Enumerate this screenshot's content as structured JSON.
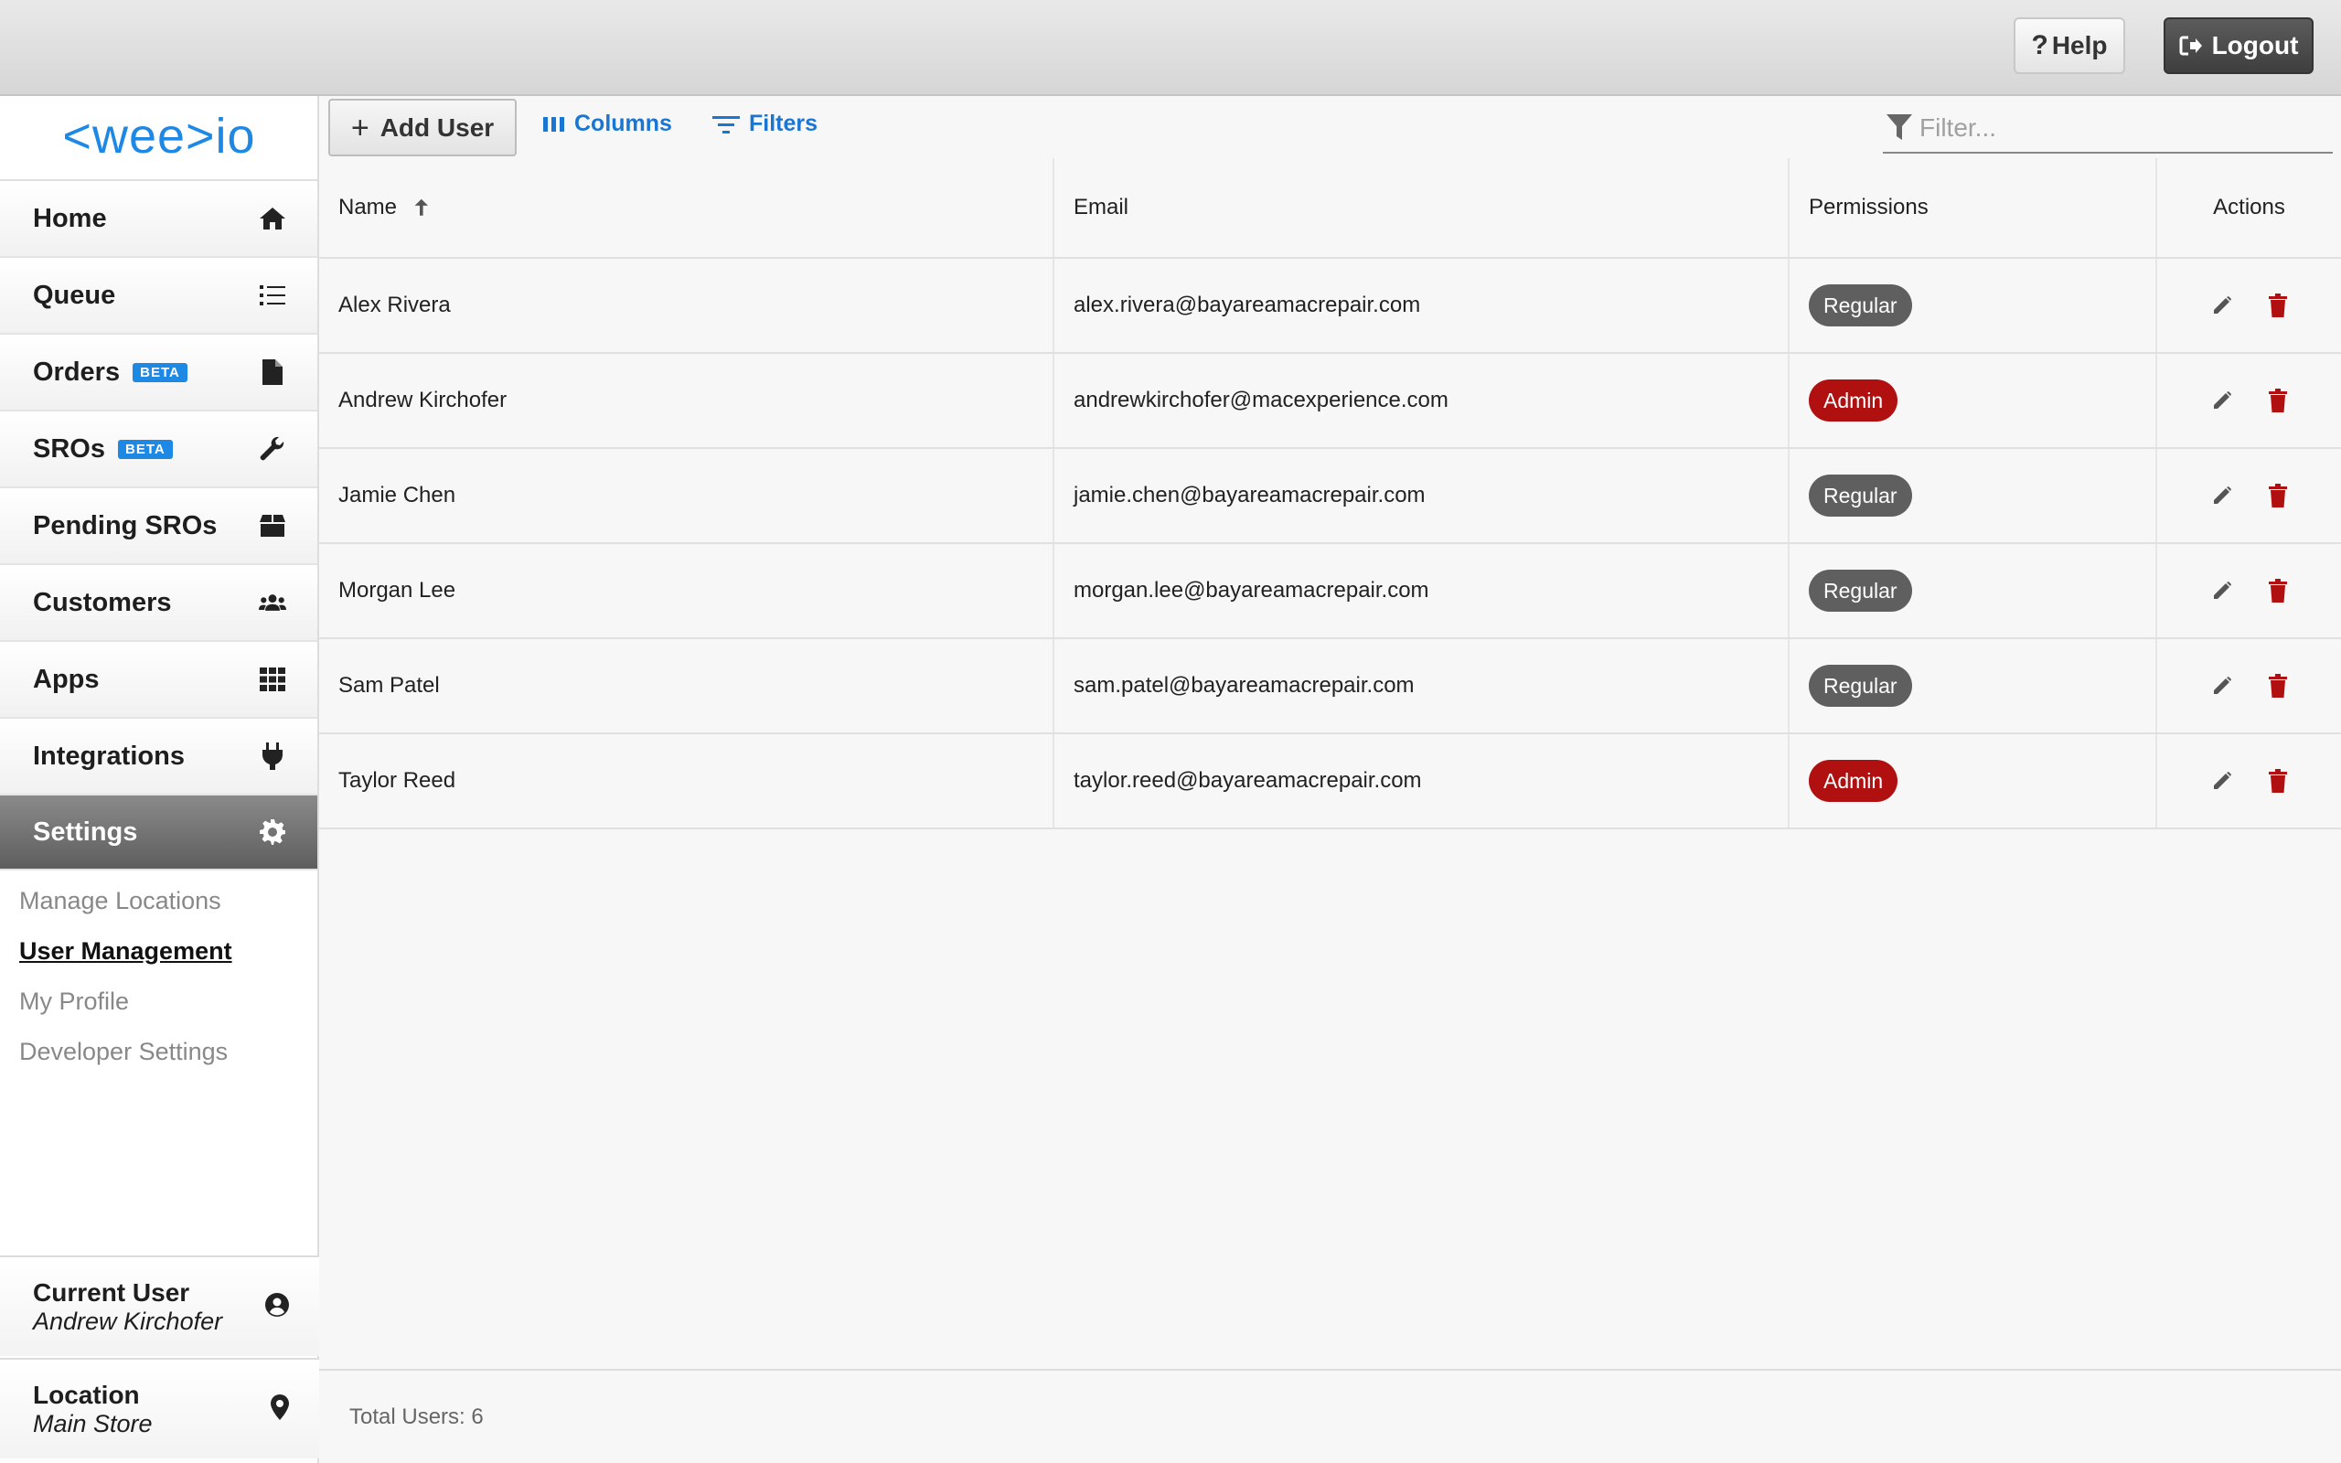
{
  "header": {
    "help_label": "Help",
    "logout_label": "Logout"
  },
  "brand": {
    "logo_text": "<wee>io",
    "color": "#1e88e5"
  },
  "sidebar": {
    "items": [
      {
        "label": "Home",
        "icon": "home-icon"
      },
      {
        "label": "Queue",
        "icon": "list-icon"
      },
      {
        "label": "Orders",
        "badge": "BETA",
        "icon": "file-icon"
      },
      {
        "label": "SROs",
        "badge": "BETA",
        "icon": "wrench-icon"
      },
      {
        "label": "Pending SROs",
        "icon": "box-icon"
      },
      {
        "label": "Customers",
        "icon": "users-icon"
      },
      {
        "label": "Apps",
        "icon": "grid-icon"
      },
      {
        "label": "Integrations",
        "icon": "plug-icon"
      },
      {
        "label": "Settings",
        "icon": "gear-icon",
        "active": true
      }
    ],
    "settings_sub": [
      "Manage Locations",
      "User Management",
      "My Profile",
      "Developer Settings"
    ],
    "current_user": {
      "title": "Current User",
      "value": "Andrew Kirchofer"
    },
    "location": {
      "title": "Location",
      "value": "Main Store"
    }
  },
  "toolbar": {
    "add_user_label": "Add User",
    "columns_label": "Columns",
    "filters_label": "Filters",
    "filter_placeholder": "Filter..."
  },
  "table": {
    "columns": [
      "Name",
      "Email",
      "Permissions",
      "Actions"
    ],
    "rows": [
      {
        "name": "Alex Rivera",
        "email": "alex.rivera@bayareamacrepair.com",
        "permission": "Regular"
      },
      {
        "name": "Andrew Kirchofer",
        "email": "andrewkirchofer@macexperience.com",
        "permission": "Admin"
      },
      {
        "name": "Jamie Chen",
        "email": "jamie.chen@bayareamacrepair.com",
        "permission": "Regular"
      },
      {
        "name": "Morgan Lee",
        "email": "morgan.lee@bayareamacrepair.com",
        "permission": "Regular"
      },
      {
        "name": "Sam Patel",
        "email": "sam.patel@bayareamacrepair.com",
        "permission": "Regular"
      },
      {
        "name": "Taylor Reed",
        "email": "taylor.reed@bayareamacrepair.com",
        "permission": "Admin"
      }
    ]
  },
  "footer": {
    "total_label": "Total Users: 6"
  },
  "colors": {
    "accent": "#1976d2",
    "admin": "#b01010",
    "regular": "#5f5f5f",
    "delete": "#b01010"
  }
}
